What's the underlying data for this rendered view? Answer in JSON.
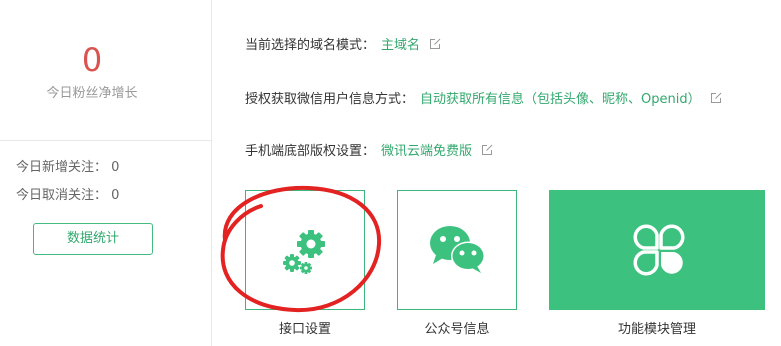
{
  "stats": {
    "fans_count": "0",
    "fans_label": "今日粉丝净增长",
    "new_follow": "今日新增关注： 0",
    "cancel_follow": "今日取消关注： 0",
    "stats_button": "数据统计"
  },
  "settings": [
    {
      "label": "当前选择的域名模式：",
      "value": "主域名",
      "icon": "edit-icon"
    },
    {
      "label": "授权获取微信用户信息方式：",
      "value": "自动获取所有信息（包括头像、昵称、Openid）",
      "icon": "edit-icon"
    },
    {
      "label": "手机端底部版权设置：",
      "value": "微讯云端免费版",
      "icon": "edit-icon"
    }
  ],
  "tiles": [
    {
      "caption": "接口设置",
      "icon": "gears-icon"
    },
    {
      "caption": "公众号信息",
      "icon": "wechat-icon"
    },
    {
      "caption": "功能模块管理",
      "icon": "modules-icon"
    }
  ],
  "colors": {
    "accent_green": "#3cc17f",
    "text_green": "#33a86e",
    "count_red": "#d9534f",
    "annotation_red": "#e32222"
  }
}
